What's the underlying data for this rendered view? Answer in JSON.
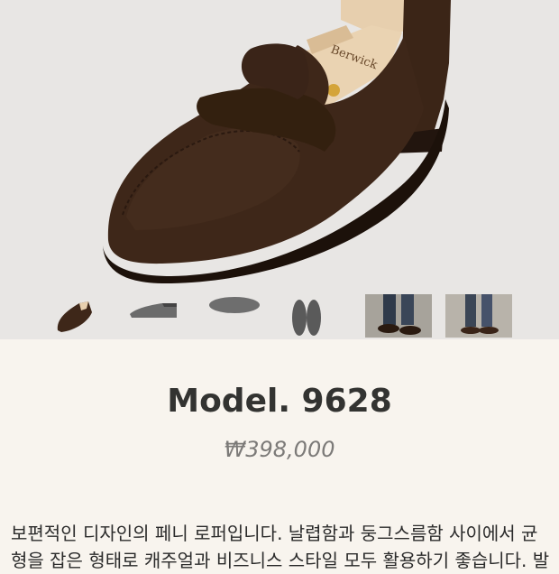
{
  "product": {
    "model": "Model. 9628",
    "price": "₩398,000",
    "description_line1": "보편적인 디자인의 페니 로퍼입니다. 날렵함과 둥그스름함 사이에서 균",
    "description_line2": "형을 잡은 형태로 캐주얼과 비즈니스 스타일 모두 활용하기 좋습니다. 발",
    "shoe_tree_brand": "Berwick"
  },
  "thumbnails": [
    {
      "name": "thumb-side-view"
    },
    {
      "name": "thumb-profile-view"
    },
    {
      "name": "thumb-sole-view"
    },
    {
      "name": "thumb-top-view"
    },
    {
      "name": "thumb-worn-photo-1"
    },
    {
      "name": "thumb-worn-photo-2"
    }
  ],
  "colors": {
    "hero_bg": "#e8e6e4",
    "info_bg": "#f8f4ee",
    "suede": "#3a2418",
    "title": "#333331",
    "price": "#7c7a78"
  }
}
